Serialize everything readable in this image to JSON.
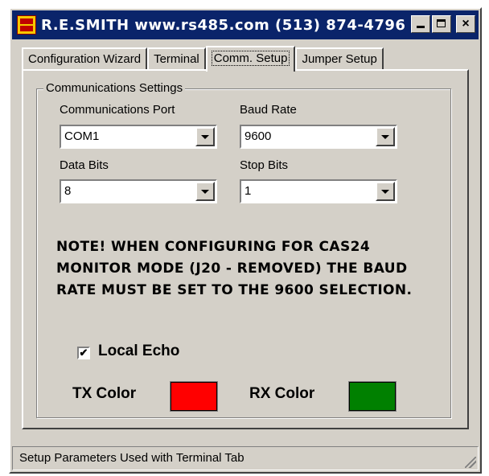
{
  "window": {
    "title": "R.E.SMITH  www.rs485.com  (513) 874-4796"
  },
  "tabs": [
    {
      "label": "Configuration Wizard",
      "active": false
    },
    {
      "label": "Terminal",
      "active": false
    },
    {
      "label": "Comm. Setup",
      "active": true
    },
    {
      "label": "Jumper Setup",
      "active": false
    }
  ],
  "comm": {
    "group_title": "Communications Settings",
    "port_label": "Communications Port",
    "port_value": "COM1",
    "baud_label": "Baud Rate",
    "baud_value": "9600",
    "data_bits_label": "Data Bits",
    "data_bits_value": "8",
    "stop_bits_label": "Stop Bits",
    "stop_bits_value": "1",
    "note_line1": "NOTE!   WHEN CONFIGURING FOR CAS24",
    "note_line2": "MONITOR MODE (J20 - REMOVED) THE BAUD",
    "note_line3": "RATE MUST BE  SET TO THE 9600 SELECTION.",
    "local_echo_label": "Local Echo",
    "local_echo_checked": true,
    "tx_color_label": "TX Color",
    "tx_color": "#ff0000",
    "rx_color_label": "RX Color",
    "rx_color": "#008000"
  },
  "status": {
    "text": "Setup Parameters Used with Terminal Tab"
  }
}
